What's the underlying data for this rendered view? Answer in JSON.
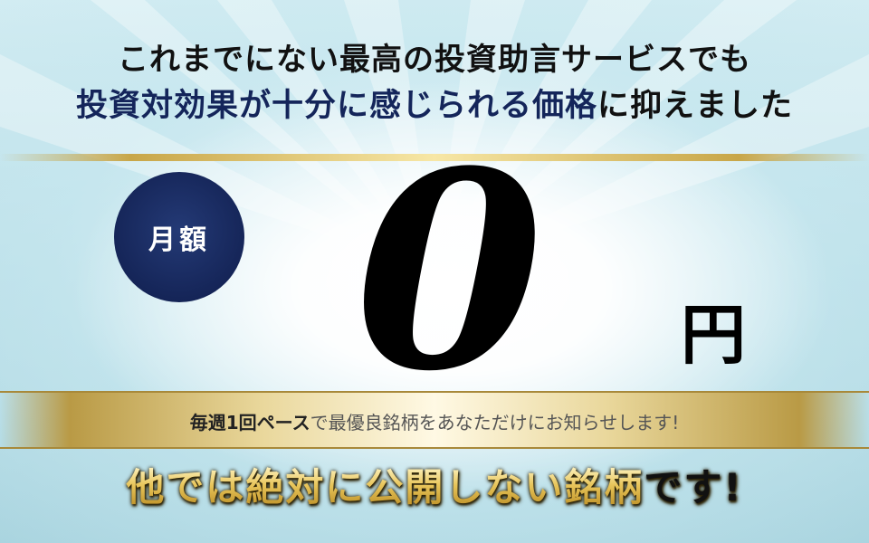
{
  "headline": {
    "line1": "これまでにない最高の投資助言サービスでも",
    "line2_emphasis": "投資対効果が十分に感じられる価格",
    "line2_rest": "に抑えました"
  },
  "price": {
    "badge_label": "月額",
    "amount": "0",
    "unit": "円"
  },
  "band": {
    "bold_part1": "毎週1回",
    "light_part1": "ペース",
    "rest": "で最優良銘柄をあなただけにお知らせします!"
  },
  "bottom": {
    "gold_part": "他では絶対に公開しない銘柄",
    "black_part": "です!"
  },
  "colors": {
    "navy": "#14255a",
    "gold": "#c8a648",
    "sky": "#b8dde6"
  }
}
